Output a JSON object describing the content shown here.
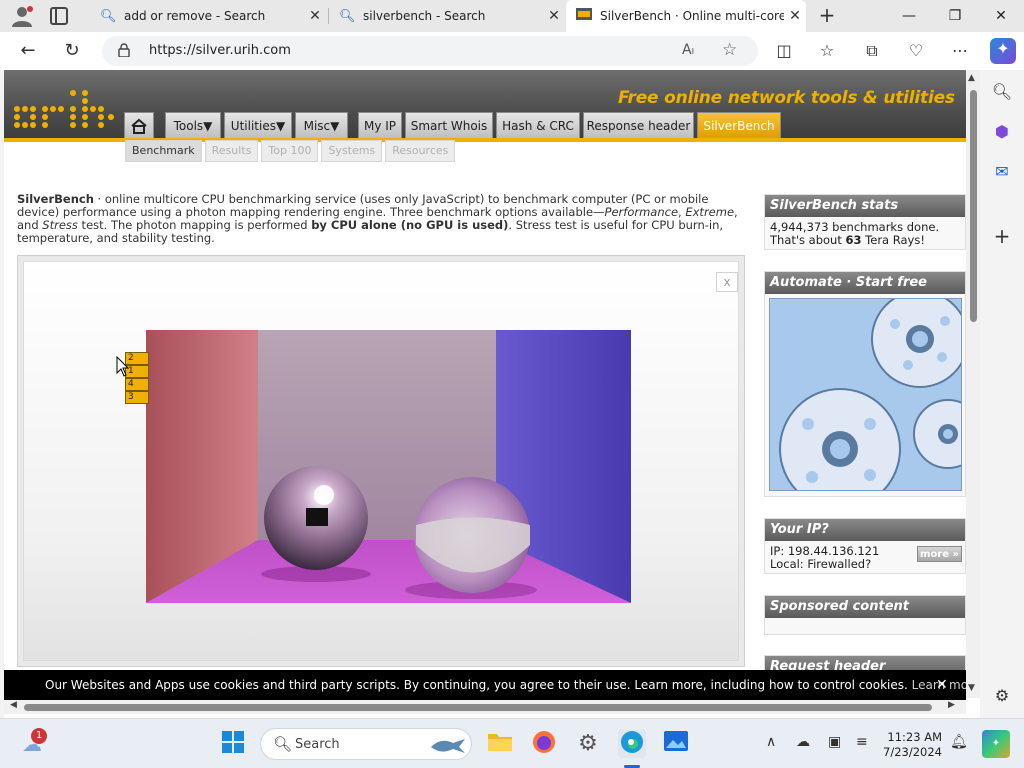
{
  "browser": {
    "tabs": [
      {
        "title": "add or remove - Search",
        "icon": "search-icon"
      },
      {
        "title": "silverbench - Search",
        "icon": "search-icon"
      },
      {
        "title": "SilverBench · Online multi-core C",
        "icon": "site-favicon"
      }
    ],
    "new_tab": "+",
    "url": "https://silver.urih.com",
    "window_controls": {
      "minimize": "—",
      "restore": "❐",
      "close": "✕"
    }
  },
  "site": {
    "tagline": "Free online network tools & utilities",
    "nav": [
      {
        "label": "Tools▼"
      },
      {
        "label": "Utilities▼"
      },
      {
        "label": "Misc▼"
      },
      {
        "label": "My IP"
      },
      {
        "label": "Smart Whois"
      },
      {
        "label": "Hash & CRC"
      },
      {
        "label": "Response header"
      },
      {
        "label": "SilverBench"
      }
    ],
    "subnav": [
      "Benchmark",
      "Results",
      "Top 100",
      "Systems",
      "Resources"
    ],
    "active_color": "#f0b000"
  },
  "intro": {
    "name": "SilverBench",
    "t1": " · online multicore CPU benchmarking service (uses only JavaScript) to benchmark computer (PC or mobile device) performance using a photon mapping rendering engine. Three benchmark options available—",
    "opt1": "Performance",
    "t2": ", ",
    "opt2": "Extreme",
    "t3": ", and ",
    "opt3": "Stress",
    "t4": " test. The photon mapping is performed ",
    "bold": "by CPU alone (no GPU is used)",
    "t5": ". Stress test is useful for CPU burn-in, temperature, and stability testing."
  },
  "benchmark": {
    "close": "x",
    "threads": [
      "2",
      "1",
      "4",
      "3"
    ]
  },
  "sidebar": {
    "stats_title": "SilverBench stats",
    "stats_line1": "4,944,373 benchmarks done.",
    "stats_line2_pre": "That's about ",
    "stats_line2_num": "63",
    "stats_line2_post": " Tera Rays!",
    "automate_title": "Automate · Start free",
    "ip_title": "Your IP?",
    "ip_line": "IP: 198.44.136.121",
    "ip_local": "Local: Firewalled?",
    "more_btn": "more »",
    "sponsored_title": "Sponsored content",
    "request_title": "Request header"
  },
  "cookie": {
    "text": "Our Websites and Apps use cookies and third party scripts. By continuing, you agree to their use. Learn more, including how to control cookies.",
    "link": "Learn more",
    "close": "✕"
  },
  "taskbar": {
    "search_placeholder": "Search",
    "time": "11:23 AM",
    "date": "7/23/2024",
    "weather_badge": "1"
  }
}
